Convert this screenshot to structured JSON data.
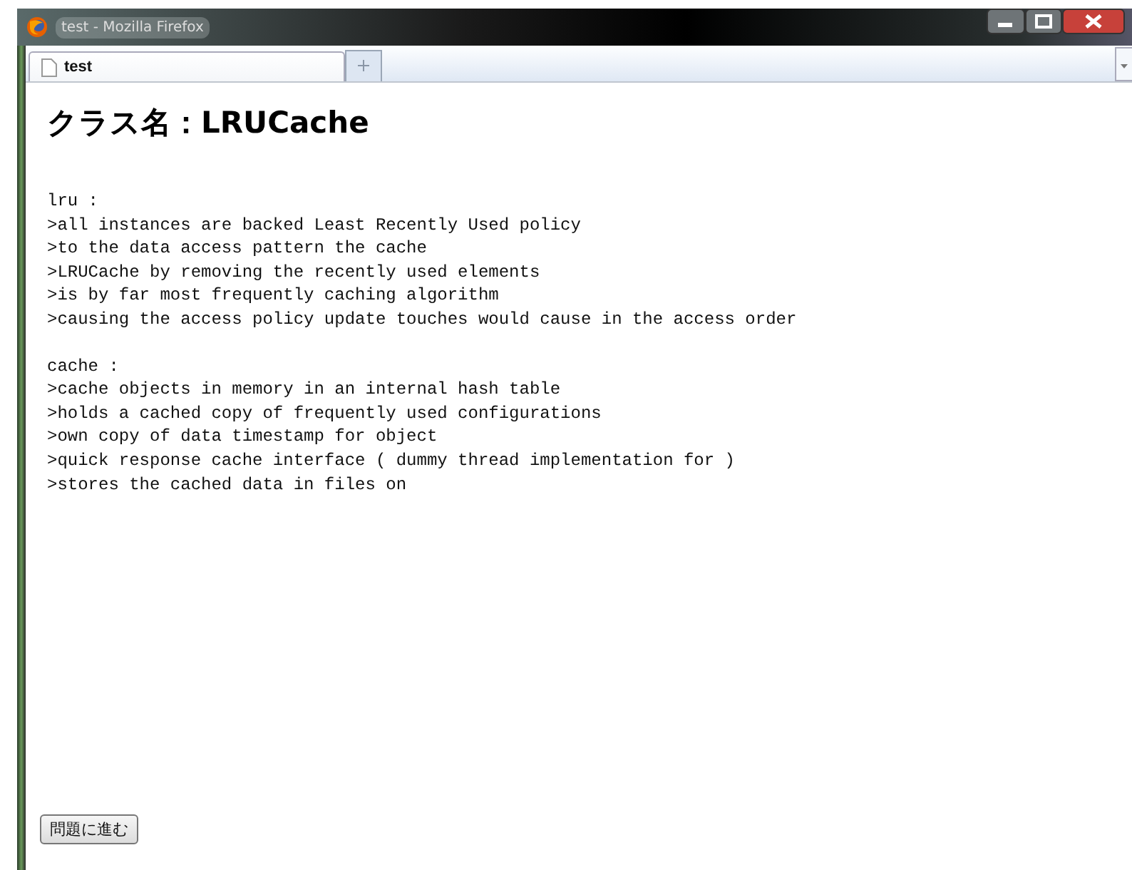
{
  "window": {
    "title": "test - Mozilla Firefox"
  },
  "tabs": [
    {
      "label": "test",
      "selected": true
    }
  ],
  "heading": "クラス名：LRUCache",
  "sections": [
    {
      "label": "lru :",
      "lines": [
        ">all instances are backed Least Recently Used policy",
        ">to the data access pattern the cache",
        ">LRUCache by removing the recently used elements",
        ">is by far most frequently caching algorithm",
        ">causing the access policy update touches would cause in the access order"
      ]
    },
    {
      "label": "cache :",
      "lines": [
        ">cache objects in memory in an internal hash table",
        ">holds a cached copy of frequently used configurations",
        ">own copy of data timestamp for object",
        ">quick response cache interface ( dummy thread implementation for )",
        ">stores the cached data in files on"
      ]
    }
  ],
  "button": "問題に進む"
}
